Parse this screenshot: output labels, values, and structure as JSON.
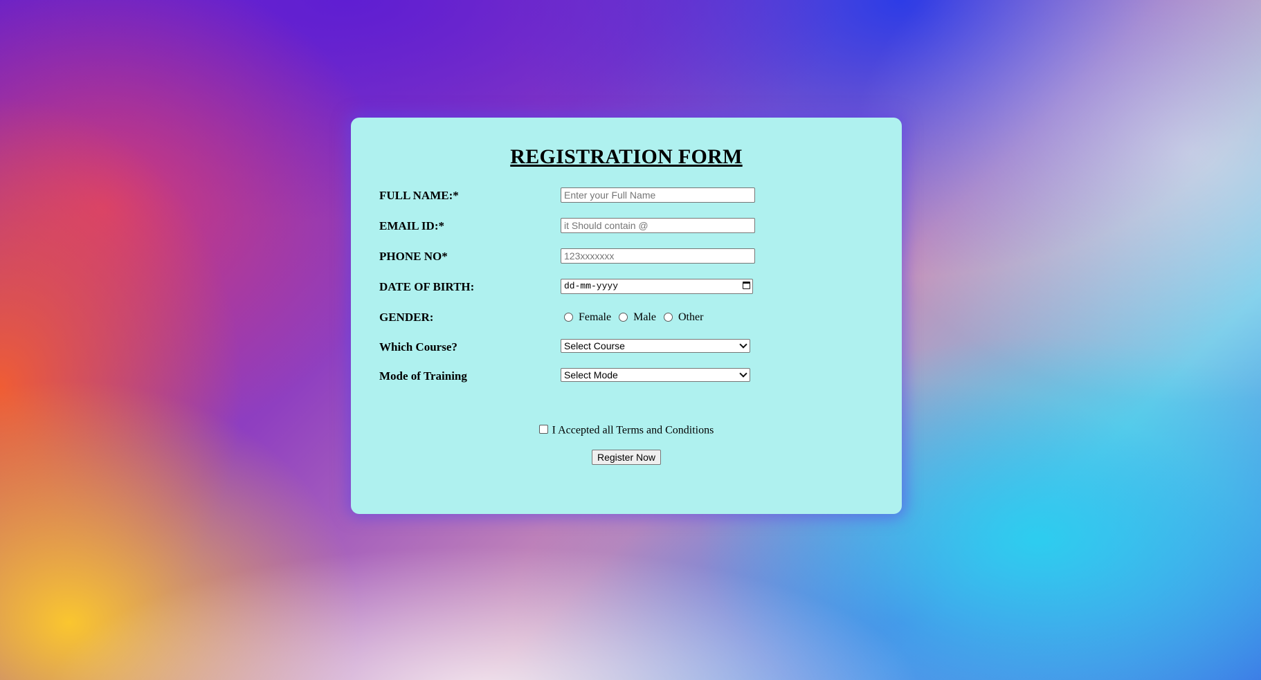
{
  "form": {
    "title": "REGISTRATION FORM",
    "full_name": {
      "label": "FULL NAME:*",
      "value": "",
      "placeholder": "Enter your Full Name"
    },
    "email": {
      "label": "EMAIL ID:*",
      "value": "",
      "placeholder": "it Should contain @"
    },
    "phone": {
      "label": "PHONE NO*",
      "value": "",
      "placeholder": "123xxxxxxx"
    },
    "dob": {
      "label": "DATE OF BIRTH:",
      "placeholder": "dd-mm-yyyy",
      "icon": "calendar-icon"
    },
    "gender": {
      "label": "GENDER:",
      "options": [
        "Female",
        "Male",
        "Other"
      ],
      "selected": null
    },
    "course": {
      "label": "Which Course?",
      "selected": "Select Course"
    },
    "mode": {
      "label": "Mode of Training",
      "selected": "Select Mode"
    },
    "terms": {
      "label": "I Accepted all Terms and Conditions",
      "checked": false
    },
    "submit_label": "Register Now"
  },
  "colors": {
    "card_background": "#aff1ef",
    "card_glow": "#5f46e6"
  }
}
